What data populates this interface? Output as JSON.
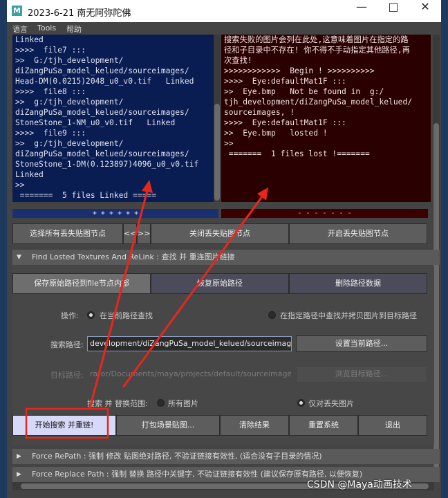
{
  "window": {
    "title": "2023-6-21  南无阿弥陀佛",
    "app_icon": "M"
  },
  "menubar": {
    "items": [
      "语言",
      "Tools",
      "帮助"
    ]
  },
  "log_left": {
    "lines": [
      "Linked",
      ">>>>  file7 :::",
      ">>  G:/tjh_development/",
      "diZangPuSa_model_kelued/sourceimages/",
      "Head-DM(0.0215)2048_u0_v0.tif   Linked",
      ">>>>  file8 :::",
      ">>  g:/tjh_development/",
      "diZangPuSa_model_kelued/sourceimages/",
      "StoneStone_1-NM_u0_v0.tif   Linked",
      ">>>>  file9 :::",
      ">>  g:/tjh_development/",
      "diZangPuSa_model_kelued/sourceimages/",
      "StoneStone_1-DM(0.123897)4096_u0_v0.tif",
      "Linked",
      ">>",
      " =======  5 files Linked ====="
    ]
  },
  "log_right": {
    "lines": [
      "搜索失败的图片会列在此处,这意味着图片在指定的路",
      "径和子目录中不存在! 你不得不手动指定其他路径,再",
      "次查找!",
      "",
      ">>>>>>>>>>>>  Begin ! >>>>>>>>>>",
      "",
      ">>>>  Eye:defaultMat1F :::",
      ">>  Eye.bmp   Not be found in  g:/",
      "tjh_development/diZangPuSa_model_kelued/",
      "sourceimages, !",
      ">>>>  Eye:defaultMat1F :::",
      ">>  Eye.bmp   losted !",
      ">>",
      " =======  1 files lost !======="
    ]
  },
  "status": {
    "left": "+ + + + + +",
    "right": "- - - - - - -"
  },
  "toolbar": {
    "select_missing": "选择所有丢失贴图节点",
    "prev": "<<",
    "next": ">>",
    "close_missing": "关闭丢失贴图节点",
    "open_missing": "开启丢失贴图节点"
  },
  "section_find": {
    "title": "Find Losted Textures  And  ReLink : 查找 并 重连图片链接"
  },
  "tabs": {
    "save_path": "保存原始路径到file节点内部",
    "restore_path": "恢复原始路径",
    "delete_path": "删除路径数据"
  },
  "operation": {
    "label": "操作:",
    "option_current": "在当前路径查找",
    "option_copy": "在指定路径中查找并拷贝图片到目标路径",
    "selected": "option_current"
  },
  "search_path": {
    "label": "搜索路径:",
    "value": "development/diZangPuSa_model_kelued/sourceimages/",
    "set_button": "设置当前路径..."
  },
  "target_path": {
    "label": "目标路径:",
    "value": "rator/Documents/maya/projects/default/sourceimages/",
    "browse_button": "浏览目标路径..."
  },
  "scope": {
    "label": "搜索 并 替换范围:",
    "option_all": "所有图片",
    "option_lost": "仅对丢失图片",
    "selected": "option_lost"
  },
  "actions": {
    "start": "开始搜索 并重链!",
    "pack": "打包场景贴图...",
    "clear": "清除结果",
    "reset": "重置系统",
    "exit": "退出"
  },
  "section_repath": {
    "title": "Force RePath : 强制 修改 贴图绝对路径, 不验证链接有效性, (适合没有子目录的情况)"
  },
  "section_replace": {
    "title": "Force Replace Path : 强制 替换 路径中关键字, 不验证链接有效性 (建议保存原有路径, 以便恢复)"
  },
  "watermark": "CSDN @Maya动画技术",
  "colors": {
    "annotation_red": "#e8271c",
    "highlight_button": "#d7d9f8"
  }
}
